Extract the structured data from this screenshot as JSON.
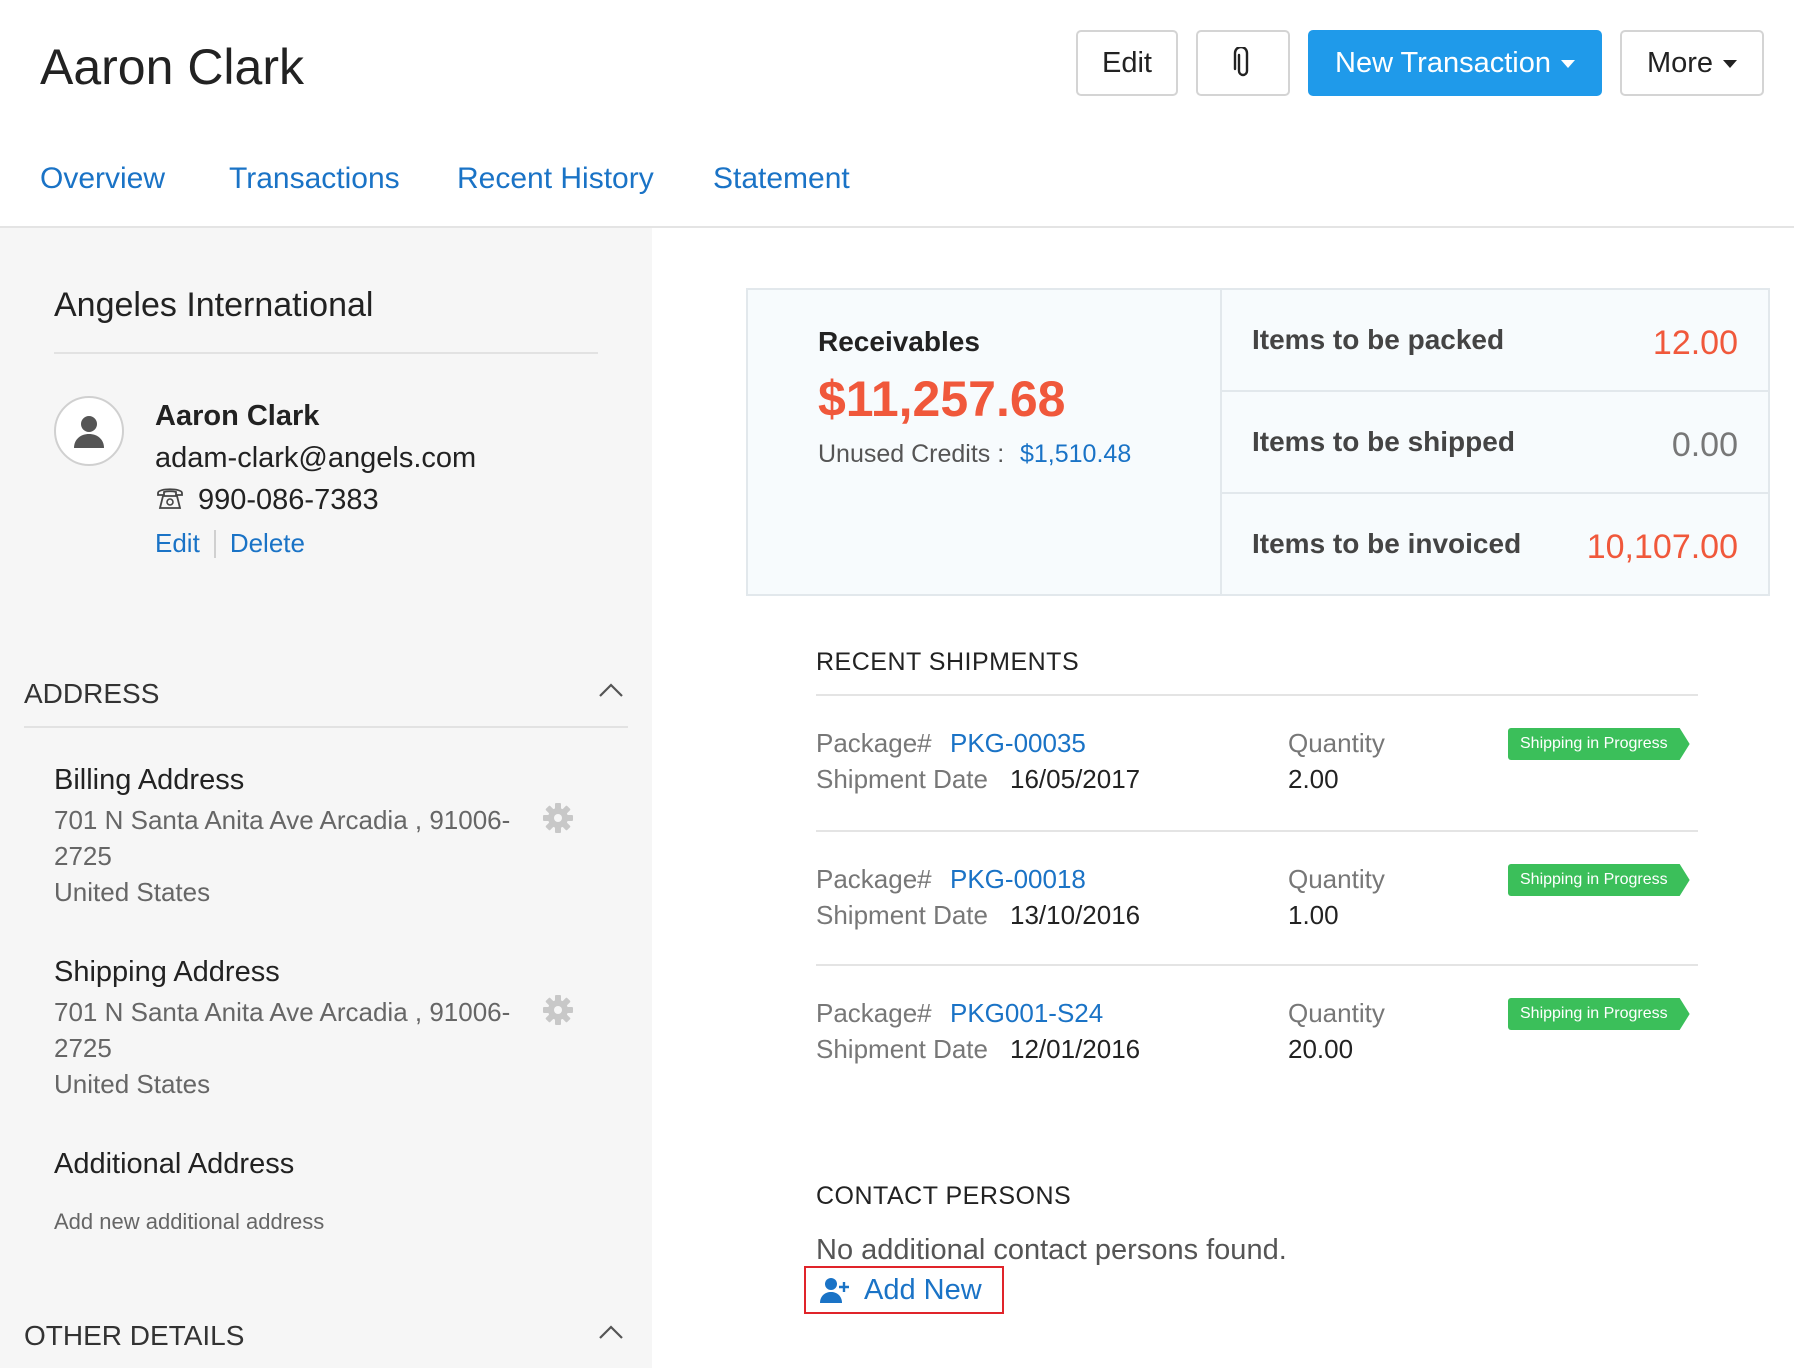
{
  "header": {
    "title": "Aaron Clark",
    "edit_label": "Edit",
    "new_transaction_label": "New Transaction",
    "more_label": "More"
  },
  "tabs": [
    {
      "label": "Overview"
    },
    {
      "label": "Transactions"
    },
    {
      "label": "Recent History"
    },
    {
      "label": "Statement"
    }
  ],
  "sidebar": {
    "company": "Angeles International",
    "contact": {
      "name": "Aaron Clark",
      "email": "adam-clark@angels.com",
      "phone": "990-086-7383",
      "edit_label": "Edit",
      "delete_label": "Delete"
    },
    "address_header": "ADDRESS",
    "billing": {
      "title": "Billing Address",
      "line1": "701 N Santa Anita Ave Arcadia , 91006-",
      "line2": "2725",
      "country": "United States"
    },
    "shipping": {
      "title": "Shipping Address",
      "line1": "701 N Santa Anita Ave Arcadia , 91006-",
      "line2": "2725",
      "country": "United States"
    },
    "additional": {
      "title": "Additional Address",
      "add_link": "Add new additional address"
    },
    "other_header": "OTHER DETAILS"
  },
  "summary": {
    "receivables_label": "Receivables",
    "receivables_amount": "$11,257.68",
    "unused_credits_label": "Unused Credits :",
    "unused_credits_value": "$1,510.48",
    "stats": [
      {
        "label": "Items to be packed",
        "value": "12.00"
      },
      {
        "label": "Items to be shipped",
        "value": "0.00"
      },
      {
        "label": "Items to be invoiced",
        "value": "10,107.00"
      }
    ]
  },
  "recent_shipments": {
    "title": "RECENT SHIPMENTS",
    "package_label": "Package#",
    "date_label": "Shipment Date",
    "quantity_label": "Quantity",
    "items": [
      {
        "package": "PKG-00035",
        "date": "16/05/2017",
        "quantity": "2.00",
        "status": "Shipping in Progress"
      },
      {
        "package": "PKG-00018",
        "date": "13/10/2016",
        "quantity": "1.00",
        "status": "Shipping in Progress"
      },
      {
        "package": "PKG001-S24",
        "date": "12/01/2016",
        "quantity": "20.00",
        "status": "Shipping in Progress"
      }
    ]
  },
  "contact_persons": {
    "title": "CONTACT PERSONS",
    "empty_text": "No additional contact persons found.",
    "add_label": "Add New"
  },
  "colors": {
    "accent": "#1f9aea",
    "link": "#1a73c6",
    "alert": "#f0583b",
    "status_green": "#3bbf5a"
  }
}
